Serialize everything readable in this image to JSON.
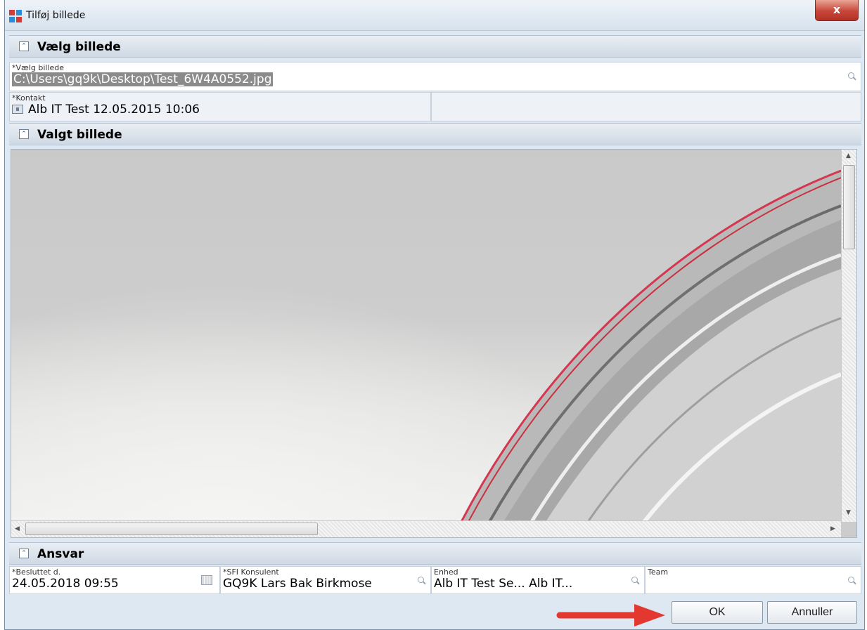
{
  "window": {
    "title": "Tilføj billede",
    "close_glyph": "x"
  },
  "sections": {
    "choose_image": {
      "title": "Vælg billede",
      "file_field": {
        "label": "*Vælg billede",
        "value": "C:\\Users\\gq9k\\Desktop\\Test_6W4A0552.jpg"
      },
      "contact_field": {
        "label": "*Kontakt",
        "value": "Alb IT Test 12.05.2015 10:06"
      }
    },
    "selected_image": {
      "title": "Valgt billede"
    },
    "responsibility": {
      "title": "Ansvar",
      "decided_field": {
        "label": "*Besluttet d.",
        "value": "24.05.2018 09:55"
      },
      "consultant_field": {
        "label": "*SFI Konsulent",
        "value": "GQ9K Lars Bak Birkmose"
      },
      "unit_field": {
        "label": "Enhed",
        "value": "Alb IT Test Se... Alb IT..."
      },
      "team_field": {
        "label": "Team",
        "value": ""
      }
    }
  },
  "buttons": {
    "ok": "OK",
    "cancel": "Annuller"
  },
  "icons": {
    "collapse": "chevron-up-icon",
    "lookup": "search-icon",
    "calendar": "calendar-icon",
    "contact": "contact-card-icon"
  },
  "colors": {
    "annotation_arrow": "#e2382f",
    "close_button": "#c8453a"
  }
}
